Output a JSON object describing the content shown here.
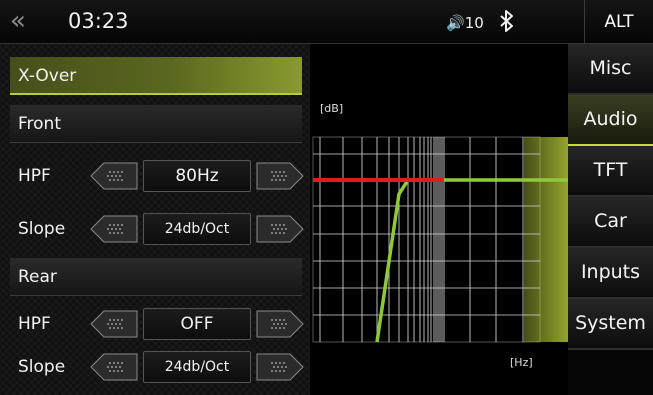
{
  "topbar": {
    "back_icon": "«",
    "time": "03:23",
    "volume": "10",
    "volume_icon": "speaker-icon",
    "bluetooth_icon": "bluetooth-icon",
    "alt_label": "ALT"
  },
  "left_panel": {
    "xover_label": "X-Over",
    "front_label": "Front",
    "front": {
      "hpf_label": "HPF",
      "hpf_value": "80Hz",
      "slope_label": "Slope",
      "slope_value": "24db/Oct"
    },
    "rear_label": "Rear",
    "rear": {
      "hpf_label": "HPF",
      "hpf_value": "OFF",
      "slope_label": "Slope",
      "slope_value": "24db/Oct"
    }
  },
  "graph": {
    "y_label": "[dB]",
    "x_label": "[Hz]",
    "colors": {
      "front_curve": "#e21b1b",
      "rear_curve": "#8fc93a",
      "highlight": "#c7db3d"
    }
  },
  "menu": {
    "items": [
      {
        "label": "Misc",
        "active": false
      },
      {
        "label": "Audio",
        "active": true
      },
      {
        "label": "TFT",
        "active": false
      },
      {
        "label": "Car",
        "active": false
      },
      {
        "label": "Inputs",
        "active": false
      },
      {
        "label": "System",
        "active": false
      }
    ]
  },
  "accent_color": "#c8da3e"
}
